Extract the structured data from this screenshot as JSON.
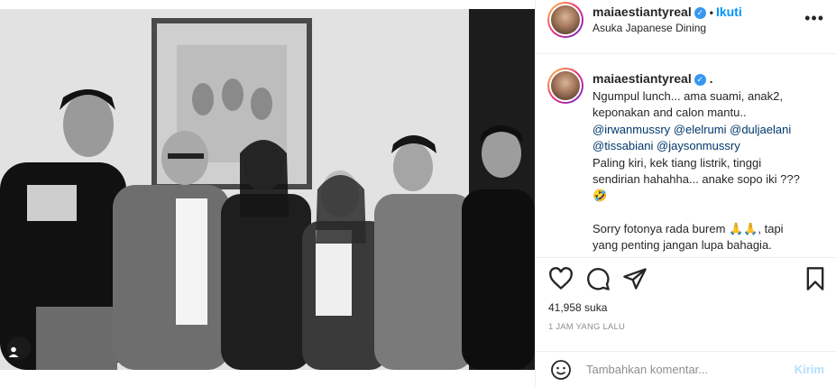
{
  "post": {
    "username": "maiaestiantyreal",
    "verified_mark": "✓",
    "separator": "•",
    "follow_label": "Ikuti",
    "location": "Asuka Japanese Dining",
    "more_icon": "more-horizontal-icon"
  },
  "caption": {
    "username": "maiaestiantyreal",
    "verified_mark": "✓",
    "trailing": ".",
    "lines": [
      "Ngumpul lunch... ama suami, anak2,",
      "keponakan and calon mantu..",
      "Paling kiri, kek tiang listrik, tinggi",
      "sendirian hahahha... anake sopo iki ???",
      "🤣",
      "Sorry fotonya rada burem 🙏🙏, tapi",
      "yang penting jangan lupa bahagia."
    ],
    "mentions_line1": [
      "@irwanmussry",
      "@elelrumi",
      "@duljaelani"
    ],
    "mentions_line2": [
      "@tissabiani",
      "@jaysonmussry"
    ]
  },
  "stats": {
    "likes": "41,958 suka",
    "time": "1 JAM YANG LALU"
  },
  "comment": {
    "placeholder": "Tambahkan komentar...",
    "send_label": "Kirim"
  },
  "icons": {
    "like": "heart-icon",
    "comment": "comment-icon",
    "share": "share-icon",
    "save": "bookmark-icon",
    "tag": "user-tag-icon",
    "emoji": "emoji-icon"
  }
}
